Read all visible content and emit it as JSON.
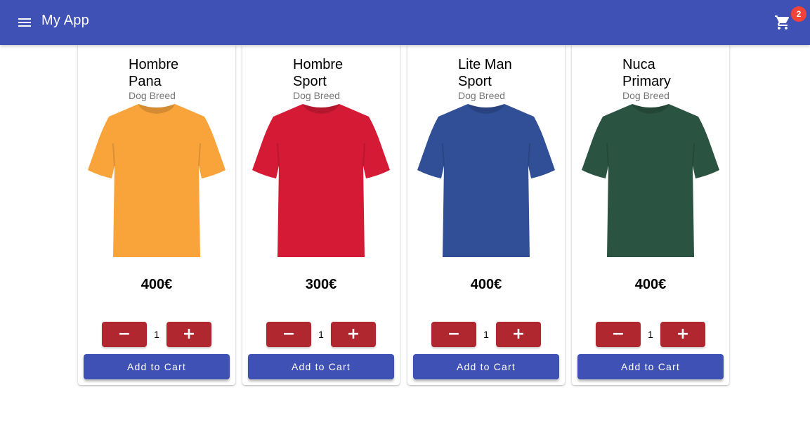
{
  "app": {
    "title": "My App",
    "menu_icon": "menu-icon",
    "cart_icon": "shopping-cart-icon",
    "cart_count": "2",
    "primary_color": "#3f51b5",
    "badge_color": "#f44336",
    "qty_button_color": "#b0272f"
  },
  "products": [
    {
      "name": "Hombre Pana",
      "subtitle": "Dog Breed",
      "price": "400€",
      "quantity": "1",
      "minus_label": "−",
      "plus_label": "+",
      "add_label": "Add to Cart",
      "shirt_color": "#f9a43a"
    },
    {
      "name": "Hombre Sport",
      "subtitle": "Dog Breed",
      "price": "300€",
      "quantity": "1",
      "minus_label": "−",
      "plus_label": "+",
      "add_label": "Add to Cart",
      "shirt_color": "#d41a35"
    },
    {
      "name": "Lite Man Sport",
      "subtitle": "Dog Breed",
      "price": "400€",
      "quantity": "1",
      "minus_label": "−",
      "plus_label": "+",
      "add_label": "Add to Cart",
      "shirt_color": "#304f96"
    },
    {
      "name": "Nuca Primary",
      "subtitle": "Dog Breed",
      "price": "400€",
      "quantity": "1",
      "minus_label": "−",
      "plus_label": "+",
      "add_label": "Add to Cart",
      "shirt_color": "#2a5341"
    }
  ]
}
